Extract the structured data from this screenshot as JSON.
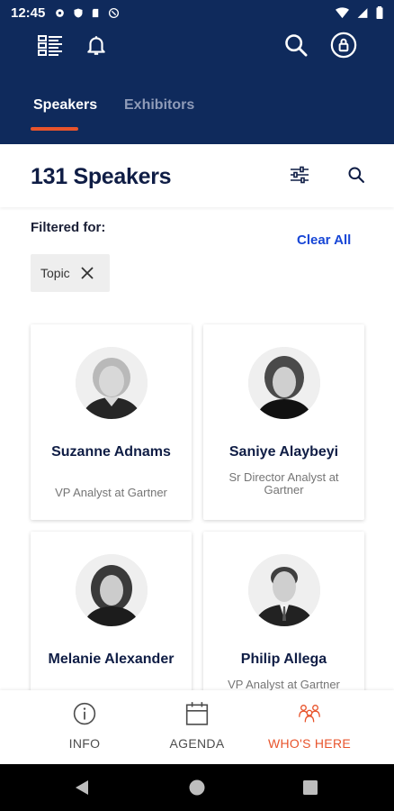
{
  "status_bar": {
    "time": "12:45"
  },
  "header": {
    "tabs": [
      {
        "label": "Speakers",
        "active": true
      },
      {
        "label": "Exhibitors",
        "active": false
      }
    ]
  },
  "main": {
    "title": "131 Speakers",
    "filtered_label": "Filtered for:",
    "clear_all": "Clear All",
    "filter_chips": [
      {
        "label": "Topic"
      }
    ],
    "speakers": [
      {
        "name": "Suzanne Adnams",
        "role": "VP Analyst at Gartner"
      },
      {
        "name": "Saniye Alaybeyi",
        "role": "Sr Director Analyst at Gartner"
      },
      {
        "name": "Melanie Alexander",
        "role": ""
      },
      {
        "name": "Philip Allega",
        "role": "VP Analyst at Gartner"
      }
    ]
  },
  "bottom_nav": {
    "items": [
      {
        "label": "INFO",
        "icon": "info-icon",
        "active": false
      },
      {
        "label": "AGENDA",
        "icon": "calendar-icon",
        "active": false
      },
      {
        "label": "WHO'S HERE",
        "icon": "people-icon",
        "active": true
      }
    ]
  },
  "colors": {
    "header_bg": "#0f2a5c",
    "accent": "#e8542c",
    "link": "#1746d6",
    "title": "#0f1d45"
  }
}
